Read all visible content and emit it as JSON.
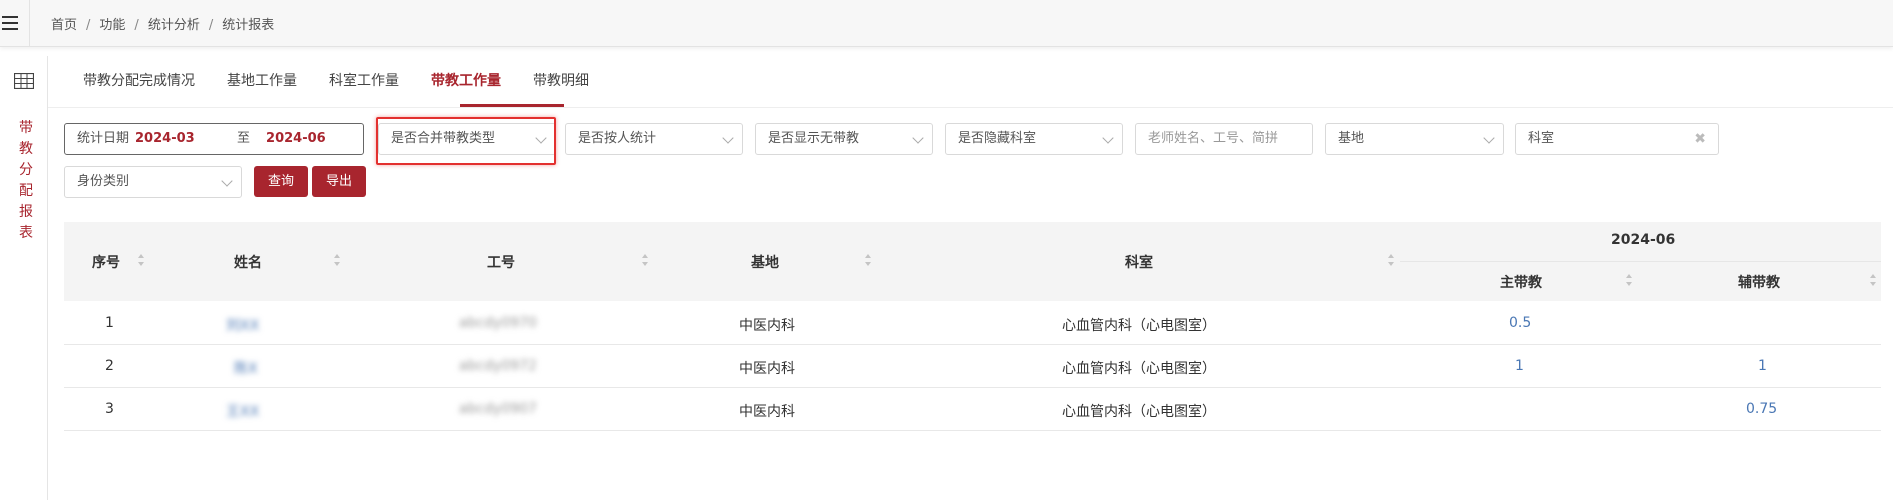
{
  "breadcrumb": [
    "首页",
    "功能",
    "统计分析",
    "统计报表"
  ],
  "sidebar": {
    "vertical_title": "带教分配报表"
  },
  "tabs": [
    "带教分配完成情况",
    "基地工作量",
    "科室工作量",
    "带教工作量",
    "带教明细"
  ],
  "active_tab": "带教工作量",
  "filters": {
    "date_label": "统计日期",
    "date_start": "2024-03",
    "date_sep": "至",
    "date_end": "2024-06",
    "merge_type": "是否合并带教类型",
    "by_person": "是否按人统计",
    "show_none": "是否显示无带教",
    "hide_dept": "是否隐藏科室",
    "teacher_placeholder": "老师姓名、工号、简拼",
    "base": "基地",
    "dept": "科室",
    "identity": "身份类别"
  },
  "buttons": {
    "query": "查询",
    "export": "导出"
  },
  "table": {
    "headers": {
      "seq": "序号",
      "name": "姓名",
      "id": "工号",
      "base": "基地",
      "dept": "科室",
      "period": "2024-06",
      "main": "主带教",
      "assist": "辅带教"
    },
    "rows": [
      {
        "seq": "1",
        "name": "刘XX",
        "id": "abcdy0970",
        "base": "中医内科",
        "dept": "心血管内科（心电图室）",
        "main": "0.5",
        "assist": ""
      },
      {
        "seq": "2",
        "name": "陈X",
        "id": "abcdy0972",
        "base": "中医内科",
        "dept": "心血管内科（心电图室）",
        "main": "1",
        "assist": "1"
      },
      {
        "seq": "3",
        "name": "王XX",
        "id": "abcdy0907",
        "base": "中医内科",
        "dept": "心血管内科（心电图室）",
        "main": "",
        "assist": "0.75"
      }
    ]
  },
  "colors": {
    "accent": "#a8252e",
    "link": "#4a77b4",
    "highlight": "#e3302f"
  }
}
